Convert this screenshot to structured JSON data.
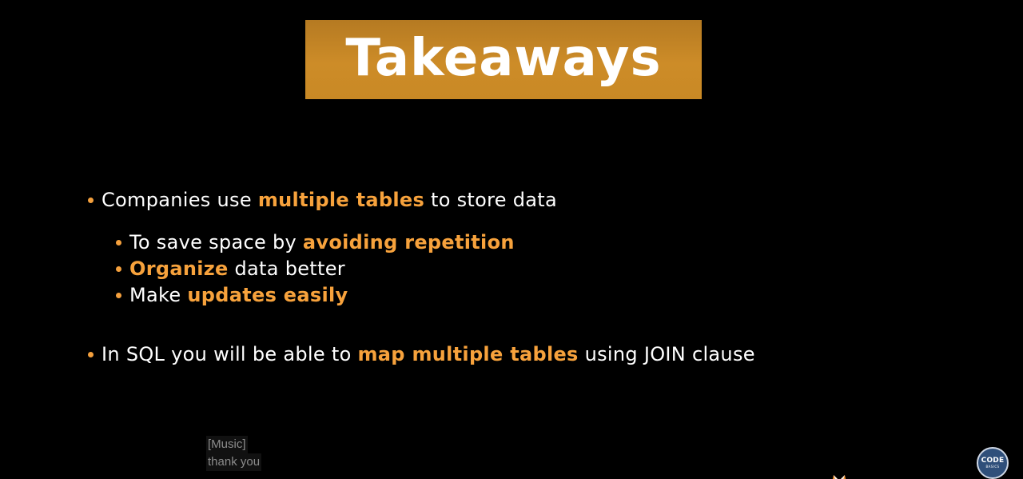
{
  "slide": {
    "title": "Takeaways",
    "bullets": [
      {
        "level": 1,
        "segments": [
          {
            "text": "Companies use ",
            "highlight": false
          },
          {
            "text": "multiple tables",
            "highlight": true
          },
          {
            "text": " to store data",
            "highlight": false
          }
        ]
      },
      {
        "level": 2,
        "segments": [
          {
            "text": "To save space by ",
            "highlight": false
          },
          {
            "text": "avoiding repetition",
            "highlight": true
          }
        ]
      },
      {
        "level": 2,
        "segments": [
          {
            "text": "Organize",
            "highlight": true
          },
          {
            "text": " data better",
            "highlight": false
          }
        ]
      },
      {
        "level": 2,
        "segments": [
          {
            "text": "Make ",
            "highlight": false
          },
          {
            "text": "updates easily",
            "highlight": true
          }
        ]
      },
      {
        "level": 1,
        "segments": [
          {
            "text": "In SQL you will be able to ",
            "highlight": false
          },
          {
            "text": "map multiple tables",
            "highlight": true
          },
          {
            "text": " using JOIN clause",
            "highlight": false
          }
        ]
      }
    ]
  },
  "captions": [
    "[Music]",
    "thank you"
  ],
  "brand": {
    "main": "CODE",
    "sub": "BASICS"
  },
  "colors": {
    "background": "#000000",
    "title_box": "#cd8c28",
    "highlight": "#f7a23c",
    "text": "#ffffff",
    "bullet_dot": "#f4a03d"
  },
  "icons": [
    "fox-icon",
    "codebasics-logo"
  ]
}
